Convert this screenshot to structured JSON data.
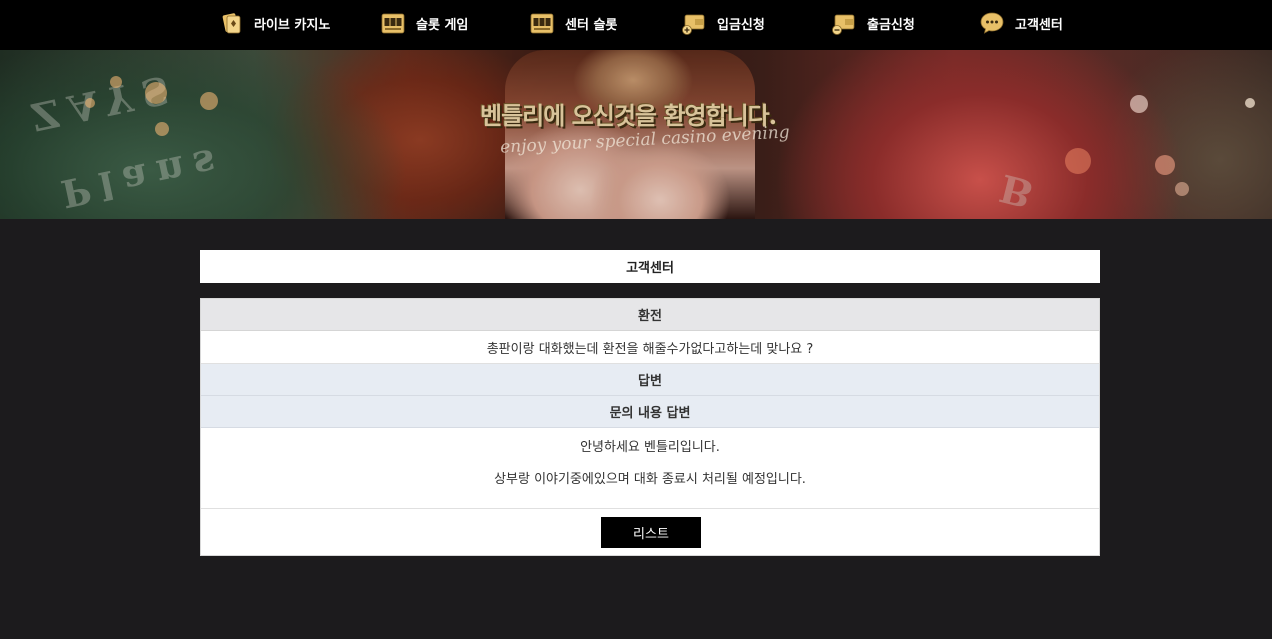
{
  "nav": {
    "items": [
      {
        "label": "라이브 카지노",
        "icon": "casino-chip-icon"
      },
      {
        "label": "슬롯 게임",
        "icon": "slot-machine-icon"
      },
      {
        "label": "센터 슬롯",
        "icon": "slot-machine-icon"
      },
      {
        "label": "입금신청",
        "icon": "deposit-wallet-icon"
      },
      {
        "label": "출금신청",
        "icon": "withdraw-wallet-icon"
      },
      {
        "label": "고객센터",
        "icon": "chat-bubble-icon"
      }
    ],
    "accent_color": "#e8c068"
  },
  "banner": {
    "title": "벤틀리에 오신것을 환영합니다.",
    "subtitle": "enjoy your special casino evening"
  },
  "page": {
    "title": "고객센터"
  },
  "inquiry": {
    "subject": "환전",
    "question": "총판이랑 대화했는데 환전을 해줄수가없다고하는데 맞나요 ?",
    "answer_header": "답변",
    "answer_title": "문의 내용 답변",
    "answer_lines": [
      "안녕하세요 벤틀리입니다.",
      "상부랑 이야기중에있으며 대화 종료시 처리될 예정입니다."
    ],
    "list_button": "리스트"
  }
}
